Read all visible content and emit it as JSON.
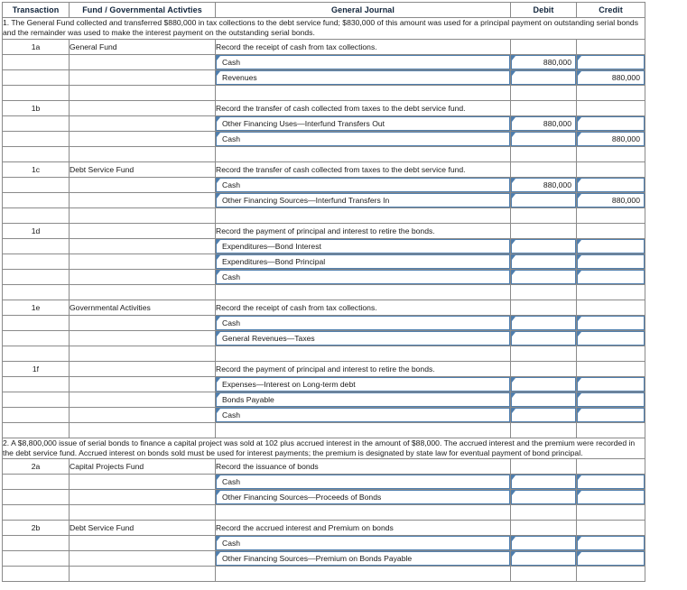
{
  "table": {
    "columns": [
      {
        "key": "transaction",
        "label": "Transaction"
      },
      {
        "key": "fund",
        "label": "Fund / Governmental Activties"
      },
      {
        "key": "journal",
        "label": "General Journal"
      },
      {
        "key": "debit",
        "label": "Debit"
      },
      {
        "key": "credit",
        "label": "Credit"
      }
    ]
  },
  "narratives": {
    "item1": "1. The General Fund collected and transferred $880,000 in tax collections to the debt service fund; $830,000 of this amount was used for a principal payment on outstanding serial bonds and the remainder was used to make the interest payment on the outstanding serial bonds.",
    "item2": "2. A $8,800,000 issue of serial bonds to finance a capital project was sold at 102 plus accrued interest in the amount of $88,000. The accrued interest and the premium were recorded in the debt service fund. Accrued interest on bonds sold must be used for interest payments; the premium is designated by state law for eventual payment of bond principal."
  },
  "entries": [
    {
      "id": "1a",
      "fund": "General Fund",
      "description": "Record the receipt of cash from tax collections.",
      "lines": [
        {
          "account": "Cash",
          "debit": "880,000",
          "credit": ""
        },
        {
          "account": "Revenues",
          "debit": "",
          "credit": "880,000"
        }
      ]
    },
    {
      "id": "1b",
      "fund": "",
      "description": "Record the transfer of cash collected from taxes to the debt service fund.",
      "lines": [
        {
          "account": "Other Financing Uses—Interfund Transfers Out",
          "debit": "880,000",
          "credit": ""
        },
        {
          "account": "Cash",
          "debit": "",
          "credit": "880,000"
        }
      ]
    },
    {
      "id": "1c",
      "fund": "Debt Service Fund",
      "description": "Record the transfer of cash collected from taxes to the debt service fund.",
      "lines": [
        {
          "account": "Cash",
          "debit": "880,000",
          "credit": ""
        },
        {
          "account": "Other Financing Sources—Interfund Transfers In",
          "debit": "",
          "credit": "880,000"
        }
      ]
    },
    {
      "id": "1d",
      "fund": "",
      "description": "Record the payment of principal and interest to retire the bonds.",
      "lines": [
        {
          "account": "Expenditures—Bond Interest",
          "debit": "",
          "credit": ""
        },
        {
          "account": "Expenditures—Bond Principal",
          "debit": "",
          "credit": ""
        },
        {
          "account": "Cash",
          "debit": "",
          "credit": ""
        }
      ]
    },
    {
      "id": "1e",
      "fund": "Governmental Activities",
      "description": "Record the receipt of cash from tax collections.",
      "lines": [
        {
          "account": "Cash",
          "debit": "",
          "credit": ""
        },
        {
          "account": "General Revenues—Taxes",
          "debit": "",
          "credit": ""
        }
      ]
    },
    {
      "id": "1f",
      "fund": "",
      "description": "Record the payment of principal and interest to retire the bonds.",
      "lines": [
        {
          "account": "Expenses—Interest on Long-term debt",
          "debit": "",
          "credit": ""
        },
        {
          "account": "Bonds Payable",
          "debit": "",
          "credit": ""
        },
        {
          "account": "Cash",
          "debit": "",
          "credit": ""
        }
      ]
    },
    {
      "id": "2a",
      "fund": "Capital Projects Fund",
      "description": "Record the issuance of bonds",
      "lines": [
        {
          "account": "Cash",
          "debit": "",
          "credit": ""
        },
        {
          "account": "Other Financing Sources—Proceeds of Bonds",
          "debit": "",
          "credit": ""
        }
      ]
    },
    {
      "id": "2b",
      "fund": "Debt Service Fund",
      "description": "Record the accrued interest and Premium on bonds",
      "lines": [
        {
          "account": "Cash",
          "debit": "",
          "credit": ""
        },
        {
          "account": "Other Financing Sources—Premium on Bonds Payable",
          "debit": "",
          "credit": ""
        }
      ]
    }
  ],
  "colors": {
    "header_bg": "#6fa8dc",
    "grid_line": "#8a8a8a",
    "field_border": "#4f7ead"
  }
}
